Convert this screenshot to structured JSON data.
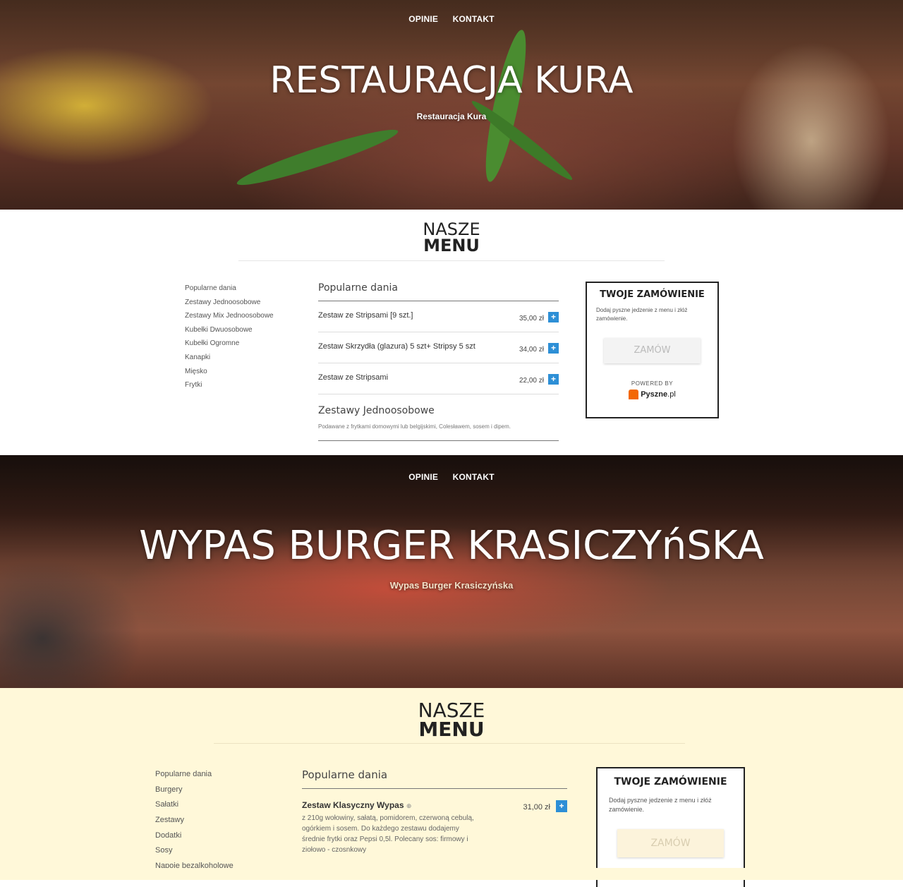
{
  "sectionA": {
    "nav": [
      "OPINIE",
      "KONTAKT"
    ],
    "title": "RESTAURACJA KURA",
    "subtitle": "Restauracja Kura",
    "menu_heading": [
      "NASZE",
      "MENU"
    ],
    "categories": [
      "Popularne dania",
      "Zestawy Jednoosobowe",
      "Zestawy Mix Jednoosobowe",
      "Kubełki Dwuosobowe",
      "Kubełki Ogromne",
      "Kanapki",
      "Mięsko",
      "Frytki"
    ],
    "section1_title": "Popularne dania",
    "items": [
      {
        "name": "Zestaw ze Stripsami [9 szt.]",
        "price": "35,00 zł"
      },
      {
        "name": "Zestaw Skrzydła (glazura) 5 szt+ Stripsy 5 szt",
        "price": "34,00 zł"
      },
      {
        "name": "Zestaw ze Stripsami",
        "price": "22,00 zł"
      }
    ],
    "section2_title": "Zestawy Jednoosobowe",
    "section2_desc": "Podawane z frytkami domowymi lub belgijskimi, Colesławem, sosem i dipem.",
    "cart": {
      "title": "TWOJE ZAMÓWIENIE",
      "text": "Dodaj pyszne jedzenie z menu i złóż zamówienie.",
      "button": "ZAMÓW",
      "powered": "POWERED BY",
      "logo": "Pyszne",
      "logo_suffix": ".pl"
    }
  },
  "sectionB": {
    "nav": [
      "OPINIE",
      "KONTAKT"
    ],
    "title": "WYPAS BURGER KRASICZYńSKA",
    "subtitle": "Wypas Burger Krasiczyńska",
    "menu_heading": [
      "NASZE",
      "MENU"
    ],
    "categories": [
      "Popularne dania",
      "Burgery",
      "Sałatki",
      "Zestawy",
      "Dodatki",
      "Sosy",
      "Napoje bezalkoholowe"
    ],
    "section1_title": "Popularne dania",
    "item": {
      "name": "Zestaw Klasyczny Wypas",
      "info_icon": "⊕",
      "price": "31,00 zł",
      "desc": "z 210g wołowiny, sałatą, pomidorem, czerwoną cebulą, ogórkiem i sosem. Do każdego zestawu dodajemy średnie frytki oraz Pepsi 0,5l. Polecany sos: firmowy i ziołowo - czosnkowy"
    },
    "cart": {
      "title": "TWOJE ZAMÓWIENIE",
      "text": "Dodaj pyszne jedzenie z menu i złóż zamówienie.",
      "button": "ZAMÓW"
    }
  },
  "icons": {
    "add": "+"
  },
  "colors": {
    "accent_blue": "#2d8fd6",
    "cream_bg": "#fff8d9",
    "pyszne_orange": "#f36805"
  }
}
